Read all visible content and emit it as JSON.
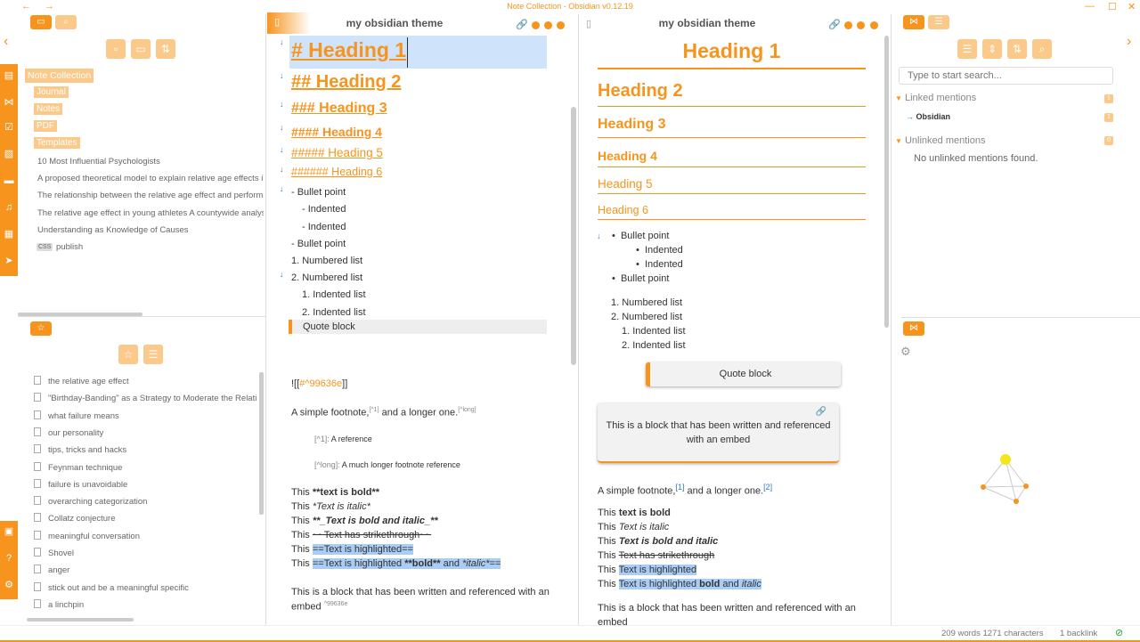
{
  "window": {
    "title": "Note Collection - Obsidian v0.12.19",
    "minimize": "—",
    "maximize": "☐",
    "close": "✕"
  },
  "left": {
    "vault_folder": "Note Collection",
    "folders": [
      "Journal",
      "Notes",
      "PDF",
      "Templates"
    ],
    "files": [
      "10 Most Influential Psychologists",
      "A proposed theoretical model to explain relative age effects in",
      "The relationship between the relative age effect and performar",
      "The relative age effect in young athletes A countywide analysis",
      "Understanding as Knowledge of Causes"
    ],
    "css_tag": "CSS",
    "publish": "publish",
    "starred": [
      "the relative age effect",
      "\"Birthday-Banding\" as a Strategy to Moderate the Relative",
      "what failure means",
      "our personality",
      "tips, tricks and hacks",
      "Feynman technique",
      "failure is unavoidable",
      "overarching categorization",
      "Collatz conjecture",
      "meaningful conversation",
      "Shovel",
      "anger",
      "stick out and be a meaningful specific",
      "a linchpin"
    ]
  },
  "editor": {
    "title": "my obsidian theme",
    "h1": "# Heading 1",
    "h2": "## Heading 2",
    "h3": "### Heading 3",
    "h4": "#### Heading 4",
    "h5": "##### Heading 5",
    "h6": "###### Heading 6",
    "bullet1": "- Bullet point",
    "indented1": "- Indented",
    "indented2": "- Indented",
    "bullet2": "- Bullet point",
    "num1": "1. Numbered list",
    "num2": "2. Numbered list",
    "ind_num1": "1. Indented list",
    "ind_num2": "2. Indented list",
    "quote": "Quote block",
    "embed_prefix": "![[",
    "embed_link": "#^99636e",
    "embed_suffix": "]]",
    "footnote_a": "A simple footnote,",
    "footnote_ref1": "[^1]",
    "footnote_b": " and a longer one.",
    "footnote_ref2": "[^long]",
    "fn1_key": "[^1]:",
    "fn1_text": " A reference",
    "fn2_key": "[^long]:",
    "fn2_text": " A much longer footnote reference",
    "this": "This ",
    "bold_src": "**text is bold**",
    "italic_src": "*Text is italic*",
    "bi_src": "**_Text is bold and italic_**",
    "strike_src": "~~Text has strikethrough~~",
    "hl_src": "==Text is highlighted==",
    "hl2_src_a": "==Text is highlighted ",
    "hl2_src_b": "**bold**",
    "hl2_src_c": " and ",
    "hl2_src_d": "*italic*",
    "hl2_src_e": "==",
    "block_text1": "This is a block that has been written and referenced with an",
    "block_text2": "embed",
    "block_id": "^99636e"
  },
  "preview": {
    "title": "my obsidian theme",
    "h1": "Heading 1",
    "h2": "Heading 2",
    "h3": "Heading 3",
    "h4": "Heading 4",
    "h5": "Heading 5",
    "h6": "Heading 6",
    "bullet1": "Bullet point",
    "indented1": "Indented",
    "indented2": "Indented",
    "bullet2": "Bullet point",
    "num1": "1. Numbered list",
    "num2": "2. Numbered list",
    "ind1": "1. Indented list",
    "ind2": "2. Indented list",
    "quote": "Quote block",
    "embed_text1": "This is a block that has been written and referenced",
    "embed_text2": "with an embed",
    "footnote_a": "A simple footnote,",
    "fn1": "[1]",
    "footnote_b": " and a longer one.",
    "fn2": "[2]",
    "this": "This ",
    "bold": "text is bold",
    "italic": "Text is italic",
    "bi": "Text is bold and italic",
    "strike": "Text has strikethrough",
    "hl": "Text is highlighted",
    "hl2_a": "Text is highlighted ",
    "hl2_b": "bold",
    "hl2_c": " and ",
    "hl2_d": "italic",
    "block_text1": "This is a block that has been written and referenced with an",
    "block_text2": "embed"
  },
  "right": {
    "search_placeholder": "Type to start search...",
    "linked": "Linked mentions",
    "linked_count": "1",
    "linked_item": "Obsidian",
    "linked_item_count": "1",
    "unlinked": "Unlinked mentions",
    "unlinked_count": "0",
    "no_unlinked": "No unlinked mentions found."
  },
  "status": {
    "words": "209 words 1271 characters",
    "backlinks": "1 backlink"
  },
  "colors": {
    "accent": "#f7941d",
    "accent_light": "#fbc989",
    "highlight": "#a9cdf5",
    "link": "#2f7bd6"
  }
}
